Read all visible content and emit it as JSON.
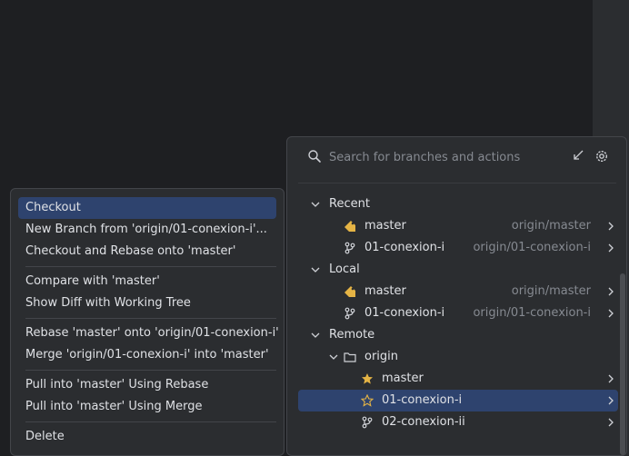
{
  "search": {
    "placeholder": "Search for branches and actions"
  },
  "tree": {
    "recent": {
      "label": "Recent",
      "items": [
        {
          "name": "master",
          "tracking": "origin/master",
          "icon": "tag-icon"
        },
        {
          "name": "01-conexion-i",
          "tracking": "origin/01-conexion-i",
          "icon": "branch-icon"
        }
      ]
    },
    "local": {
      "label": "Local",
      "items": [
        {
          "name": "master",
          "tracking": "origin/master",
          "icon": "tag-icon"
        },
        {
          "name": "01-conexion-i",
          "tracking": "origin/01-conexion-i",
          "icon": "branch-icon"
        }
      ]
    },
    "remote": {
      "label": "Remote",
      "origin": {
        "label": "origin",
        "items": [
          {
            "name": "master",
            "icon": "star-filled-icon"
          },
          {
            "name": "01-conexion-i",
            "icon": "star-outline-icon",
            "selected": true
          },
          {
            "name": "02-conexion-ii",
            "icon": "branch-icon"
          }
        ]
      }
    }
  },
  "context_menu": {
    "items": [
      "Checkout",
      "New Branch from 'origin/01-conexion-i'...",
      "Checkout and Rebase onto 'master'",
      "Compare with 'master'",
      "Show Diff with Working Tree",
      "Rebase 'master' onto 'origin/01-conexion-i'",
      "Merge 'origin/01-conexion-i' into 'master'",
      "Pull into 'master' Using Rebase",
      "Pull into 'master' Using Merge",
      "Delete"
    ]
  },
  "colors": {
    "accent": "#2e436e",
    "tag": "#e5b445",
    "star": "#e5b445",
    "muted": "#868a91"
  }
}
